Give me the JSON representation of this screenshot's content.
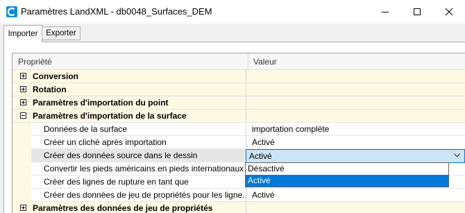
{
  "window": {
    "title": "Paramètres LandXML - db0048_Surfaces_DEM",
    "colors": {
      "accent": "#0078d7",
      "category_bg": "#fdf9e3",
      "selection_bg": "#cce4f7"
    }
  },
  "tabs": [
    {
      "label": "Importer",
      "active": true
    },
    {
      "label": "Exporter",
      "active": false
    }
  ],
  "grid": {
    "headers": {
      "property": "Propriété",
      "value": "Valeur"
    },
    "rows": [
      {
        "kind": "category",
        "label": "Conversion",
        "value": ""
      },
      {
        "kind": "category",
        "label": "Rotation",
        "value": ""
      },
      {
        "kind": "category",
        "label": "Paramètres d'importation du point",
        "value": ""
      },
      {
        "kind": "category",
        "label": "Paramètres d'importation de la surface",
        "value": ""
      },
      {
        "kind": "child",
        "label": "Données de la surface",
        "value": "importation complète"
      },
      {
        "kind": "child",
        "label": "Créer un cliché après importation",
        "value": "Activé"
      },
      {
        "kind": "child",
        "label": "Créer des données source dans le dessin",
        "value": "Activé"
      },
      {
        "kind": "child",
        "label": "Convertir les pieds américains en pieds internationaux",
        "value": ""
      },
      {
        "kind": "child",
        "label": "Créer des lignes de rupture en tant que",
        "value": ""
      },
      {
        "kind": "child",
        "label": "Créer des données de jeu de propriétés pour les ligne...",
        "value": "Activé"
      },
      {
        "kind": "category",
        "label": "Paramètres des données de jeu de propriétés",
        "value": ""
      }
    ]
  },
  "combo": {
    "selected": "Activé"
  },
  "dropdown": {
    "options": [
      "Désactivé",
      "Activé"
    ],
    "selected_index": 1
  }
}
